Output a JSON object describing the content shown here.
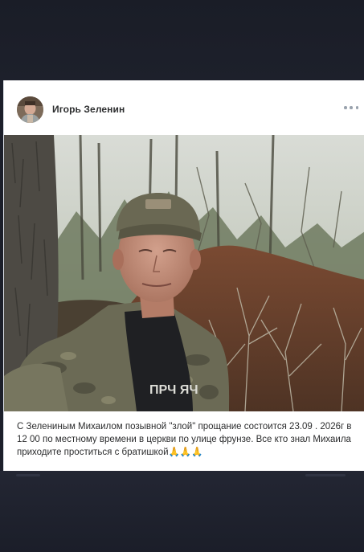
{
  "post": {
    "author_name": "Игорь Зеленин",
    "caption_text": "С Зелениным Михаилом позывной \"злой\" прощание состоится 23.09 . 2026г в 12 00 по местному времени в церкви по улице фрунзе. Все кто знал Михаила приходите проститься с братишкой",
    "caption_emoji": "🙏🙏🙏",
    "photo_text": "ПРЧ ЯЧ"
  },
  "icons": {
    "more": "more-dots-icon",
    "avatar": "user-avatar"
  },
  "colors": {
    "page_background": "#1c1f2a",
    "card_background": "#ffffff",
    "author_text": "#2c2d2e",
    "icon_gray": "#99a2ad"
  }
}
